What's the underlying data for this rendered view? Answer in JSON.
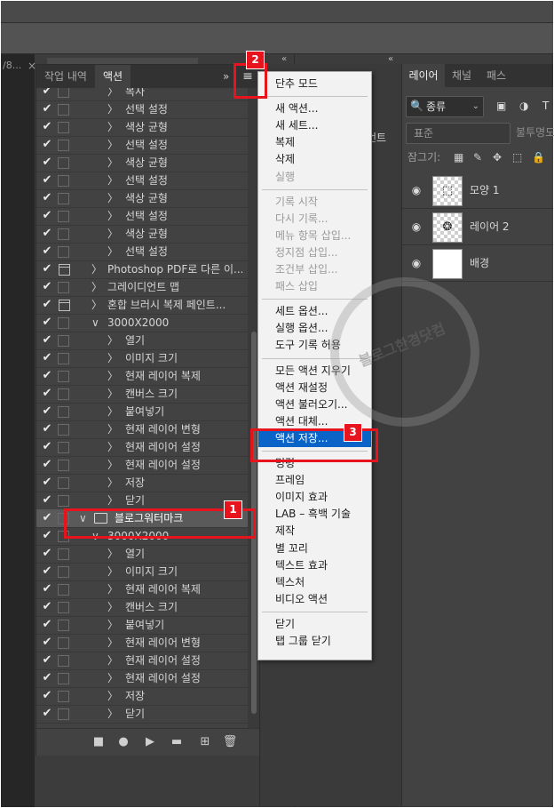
{
  "window": {
    "doc_tab_label": "/8...",
    "doc_tab_close": "×"
  },
  "actions_panel": {
    "tabs": [
      {
        "label": "작업 내역",
        "active": false
      },
      {
        "label": "액션",
        "active": true
      }
    ],
    "expand_glyph": "»",
    "menu_glyph": "≡",
    "rows": [
      {
        "label": "복사",
        "level": "step",
        "checked": true
      },
      {
        "label": "선택 설정",
        "level": "step",
        "checked": true
      },
      {
        "label": "색상 균형",
        "level": "step",
        "checked": true
      },
      {
        "label": "선택 설정",
        "level": "step",
        "checked": true
      },
      {
        "label": "색상 균형",
        "level": "step",
        "checked": true
      },
      {
        "label": "선택 설정",
        "level": "step",
        "checked": true
      },
      {
        "label": "색상 균형",
        "level": "step",
        "checked": true
      },
      {
        "label": "선택 설정",
        "level": "step",
        "checked": true
      },
      {
        "label": "색상 균형",
        "level": "step",
        "checked": true
      },
      {
        "label": "선택 설정",
        "level": "step",
        "checked": true
      },
      {
        "label": "Photoshop PDF로 다른 이...",
        "level": "action",
        "checked": true,
        "dialog": true
      },
      {
        "label": "그레이디언트 맵",
        "level": "action",
        "checked": true
      },
      {
        "label": "혼합 브러시 복제 페인트...",
        "level": "action",
        "checked": true,
        "dialog": true
      },
      {
        "label": "3000X2000",
        "level": "action-open",
        "checked": true
      },
      {
        "label": "열기",
        "level": "step",
        "checked": true
      },
      {
        "label": "이미지 크기",
        "level": "step",
        "checked": true
      },
      {
        "label": "현재 레이어 복제",
        "level": "step",
        "checked": true
      },
      {
        "label": "캔버스 크기",
        "level": "step",
        "checked": true
      },
      {
        "label": "붙여넣기",
        "level": "step",
        "checked": true
      },
      {
        "label": "현재 레이어 변형",
        "level": "step",
        "checked": true
      },
      {
        "label": "현재 레이어 설정",
        "level": "step",
        "checked": true
      },
      {
        "label": "현재 레이어 설정",
        "level": "step",
        "checked": true
      },
      {
        "label": "저장",
        "level": "step",
        "checked": true
      },
      {
        "label": "닫기",
        "level": "step",
        "checked": true
      },
      {
        "label": "블로그워터마크",
        "level": "set",
        "checked": true,
        "selected": true
      },
      {
        "label": "3000X2000",
        "level": "action-open",
        "checked": true
      },
      {
        "label": "열기",
        "level": "step",
        "checked": true
      },
      {
        "label": "이미지 크기",
        "level": "step",
        "checked": true
      },
      {
        "label": "현재 레이어 복제",
        "level": "step",
        "checked": true
      },
      {
        "label": "캔버스 크기",
        "level": "step",
        "checked": true
      },
      {
        "label": "붙여넣기",
        "level": "step",
        "checked": true
      },
      {
        "label": "현재 레이어 변형",
        "level": "step",
        "checked": true
      },
      {
        "label": "현재 레이어 설정",
        "level": "step",
        "checked": true
      },
      {
        "label": "현재 레이어 설정",
        "level": "step",
        "checked": true
      },
      {
        "label": "저장",
        "level": "step",
        "checked": true
      },
      {
        "label": "닫기",
        "level": "step",
        "checked": true
      }
    ],
    "check_glyph": "✔",
    "expand_right": "〉",
    "expand_down": "∨",
    "footer_buttons": [
      {
        "name": "stop-icon",
        "glyph": "■"
      },
      {
        "name": "record-icon",
        "glyph": "●"
      },
      {
        "name": "play-icon",
        "glyph": "▶"
      },
      {
        "name": "new-set-icon",
        "glyph": "▬"
      },
      {
        "name": "new-action-icon",
        "glyph": "⊞"
      },
      {
        "name": "delete-icon",
        "glyph": "🗑"
      }
    ]
  },
  "middle": {
    "collapse_left": "«",
    "collapse_right": "«",
    "cut_text": "언트"
  },
  "flyout_menu": {
    "items": [
      {
        "label": "단추 모드",
        "enabled": true
      },
      {
        "sep": true
      },
      {
        "label": "새 액션...",
        "enabled": true
      },
      {
        "label": "새 세트...",
        "enabled": true
      },
      {
        "label": "복제",
        "enabled": true
      },
      {
        "label": "삭제",
        "enabled": true
      },
      {
        "label": "실행",
        "enabled": false
      },
      {
        "sep": true
      },
      {
        "label": "기록 시작",
        "enabled": false
      },
      {
        "label": "다시 기록...",
        "enabled": false
      },
      {
        "label": "메뉴 항목 삽입...",
        "enabled": false
      },
      {
        "label": "정지점 삽입...",
        "enabled": false
      },
      {
        "label": "조건부 삽입...",
        "enabled": false
      },
      {
        "label": "패스 삽입",
        "enabled": false
      },
      {
        "sep": true
      },
      {
        "label": "세트 옵션...",
        "enabled": true
      },
      {
        "label": "실행 옵션...",
        "enabled": true
      },
      {
        "label": "도구 기록 허용",
        "enabled": true
      },
      {
        "sep": true
      },
      {
        "label": "모든 액션 지우기",
        "enabled": true
      },
      {
        "label": "액션 재설정",
        "enabled": true
      },
      {
        "label": "액션 불러오기...",
        "enabled": true
      },
      {
        "label": "액션 대체...",
        "enabled": true
      },
      {
        "label": "액션 저장...",
        "enabled": true,
        "highlighted": true
      },
      {
        "sep": true
      },
      {
        "label": "명령",
        "enabled": true
      },
      {
        "label": "프레임",
        "enabled": true
      },
      {
        "label": "이미지 효과",
        "enabled": true
      },
      {
        "label": "LAB – 흑백 기술",
        "enabled": true
      },
      {
        "label": "제작",
        "enabled": true
      },
      {
        "label": "별 꼬리",
        "enabled": true
      },
      {
        "label": "텍스트 효과",
        "enabled": true
      },
      {
        "label": "텍스처",
        "enabled": true
      },
      {
        "label": "비디오 액션",
        "enabled": true
      },
      {
        "sep": true
      },
      {
        "label": "닫기",
        "enabled": true
      },
      {
        "label": "탭 그룹 닫기",
        "enabled": true
      }
    ]
  },
  "layers_panel": {
    "tabs": [
      {
        "label": "레이어",
        "active": true
      },
      {
        "label": "채널",
        "active": false
      },
      {
        "label": "패스",
        "active": false
      }
    ],
    "filter_label": "종류",
    "filter_icon": "🔍",
    "dropdown_glyph": "⌄",
    "filter_icons": [
      "▣",
      "◑",
      "T"
    ],
    "blend_mode": "표준",
    "opacity_label": "불투명도",
    "lock_label": "잠그기:",
    "lock_icons": [
      "▦",
      "✎",
      "✥",
      "⬚",
      "🔒"
    ],
    "layers": [
      {
        "name": "모양 1",
        "thumb": "shape",
        "visible": true
      },
      {
        "name": "레이어 2",
        "thumb": "transparent",
        "visible": true
      },
      {
        "name": "배경",
        "thumb": "white",
        "visible": true
      }
    ],
    "eye_glyph": "◉"
  },
  "annotations": {
    "badges": [
      "1",
      "2",
      "3"
    ]
  },
  "watermark": {
    "text": "블로그한경닷컴"
  },
  "colors": {
    "panel_bg": "#424242",
    "menu_highlight": "#0a64c8",
    "annotation_red": "#e8141d"
  }
}
